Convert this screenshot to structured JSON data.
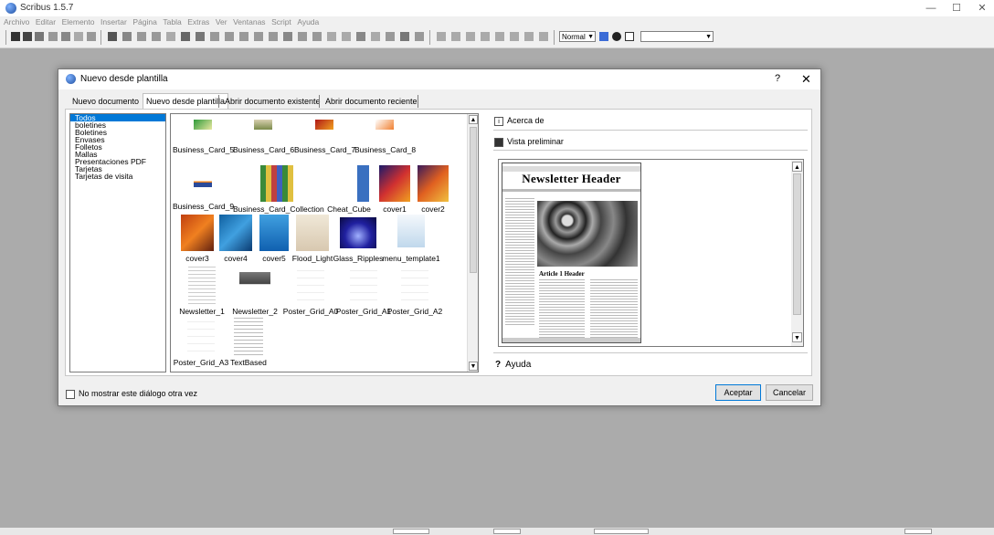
{
  "app": {
    "title": "Scribus 1.5.7"
  },
  "window_controls": {
    "minimize": "—",
    "maximize": "☐",
    "close": "✕"
  },
  "menu": [
    "Archivo",
    "Editar",
    "Elemento",
    "Insertar",
    "Página",
    "Tabla",
    "Extras",
    "Ver",
    "Ventanas",
    "Script",
    "Ayuda"
  ],
  "toolbar": {
    "style_value": "Normal",
    "style_arrow": "▼",
    "font_arrow": "▼",
    "font_value": ""
  },
  "dialog": {
    "title": "Nuevo desde plantilla",
    "help": "?",
    "close": "✕",
    "tabs": [
      "Nuevo documento",
      "Nuevo desde plantilla",
      "Abrir documento existente",
      "Abrir documento reciente"
    ],
    "categories": [
      "Todos",
      "boletines",
      "Boletines",
      "Envases",
      "Folletos",
      "Mallas",
      "Presentaciones PDF",
      "Tarjetas",
      "Tarjetas de visita"
    ],
    "templates": [
      {
        "name": "Business_Card_5"
      },
      {
        "name": "Business_Card_6"
      },
      {
        "name": "Business_Card_7"
      },
      {
        "name": "Business_Card_8"
      },
      {
        "name": "Business_Card_9"
      },
      {
        "name": "Business_Card_Collection"
      },
      {
        "name": "Cheat_Cube"
      },
      {
        "name": "cover1"
      },
      {
        "name": "cover2"
      },
      {
        "name": "cover3"
      },
      {
        "name": "cover4"
      },
      {
        "name": "cover5"
      },
      {
        "name": "Flood_Light"
      },
      {
        "name": "Glass_Ripples"
      },
      {
        "name": "menu_template1"
      },
      {
        "name": "Newsletter_1"
      },
      {
        "name": "Newsletter_2"
      },
      {
        "name": "Poster_Grid_A0"
      },
      {
        "name": "Poster_Grid_A1"
      },
      {
        "name": "Poster_Grid_A2"
      },
      {
        "name": "Poster_Grid_A3"
      },
      {
        "name": "TextBased"
      }
    ],
    "about_label": "Acerca de",
    "preview_label": "Vista preliminar",
    "help_label": "Ayuda",
    "preview": {
      "header": "Newsletter Header",
      "article": "Article 1 Header"
    },
    "dont_show": "No mostrar este diálogo otra vez",
    "accept": "Aceptar",
    "cancel": "Cancelar"
  }
}
